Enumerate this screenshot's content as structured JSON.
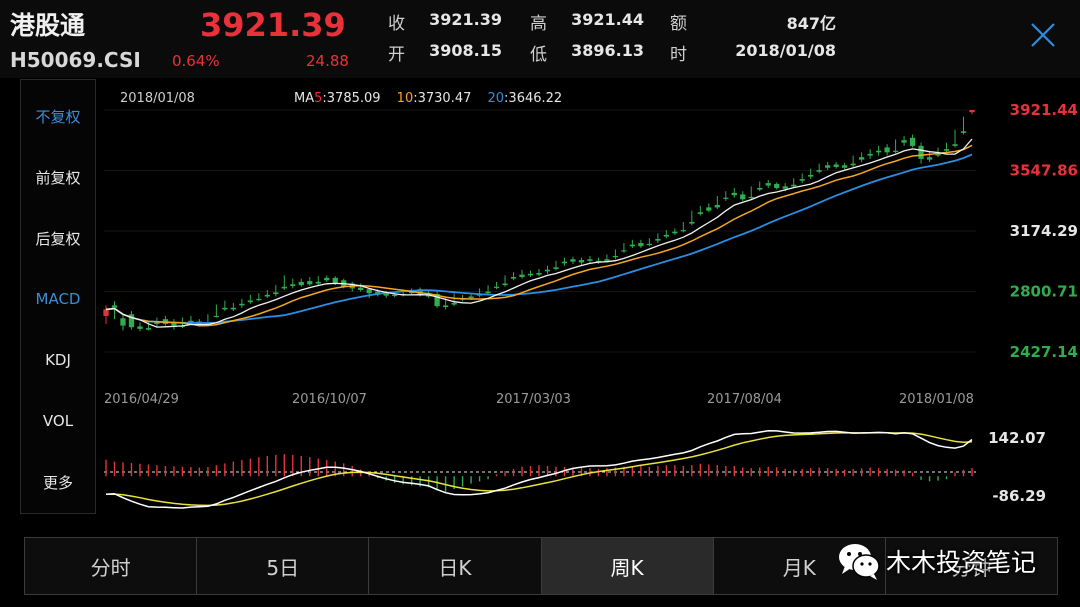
{
  "header": {
    "name": "港股通",
    "code": "H50069.CSI",
    "price": "3921.39",
    "change_pct": "0.64%",
    "change": "24.88",
    "quote": [
      {
        "label": "收",
        "value": "3921.39"
      },
      {
        "label": "高",
        "value": "3921.44"
      },
      {
        "label": "额",
        "value": "847亿"
      },
      {
        "label": "开",
        "value": "3908.15"
      },
      {
        "label": "低",
        "value": "3896.13"
      },
      {
        "label": "时",
        "value": "2018/01/08"
      }
    ]
  },
  "sidebar": {
    "items": [
      {
        "label": "不复权",
        "active": true
      },
      {
        "label": "前复权",
        "active": false
      },
      {
        "label": "后复权",
        "active": false
      },
      {
        "label": "MACD",
        "active": true
      },
      {
        "label": "KDJ",
        "active": false
      },
      {
        "label": "VOL",
        "active": false
      },
      {
        "label": "更多",
        "active": false
      }
    ]
  },
  "legend": {
    "date": "2018/01/08",
    "ma5_prefix": "MA",
    "ma5_num": "5",
    "ma5_value": ":3785.09",
    "ma10_num": "10",
    "ma10_value": ":3730.47",
    "ma20_num": "20",
    "ma20_value": ":3646.22"
  },
  "price_axis": [
    "3921.44",
    "3547.86",
    "3174.29",
    "2800.71",
    "2427.14"
  ],
  "date_axis": [
    "2016/04/29",
    "2016/10/07",
    "2017/03/03",
    "2017/08/04",
    "2018/01/08"
  ],
  "macd_axis": [
    "142.07",
    "-86.29"
  ],
  "tabs": [
    {
      "label": "分时",
      "active": false
    },
    {
      "label": "5日",
      "active": false
    },
    {
      "label": "日K",
      "active": false
    },
    {
      "label": "周K",
      "active": true
    },
    {
      "label": "月K",
      "active": false
    },
    {
      "label": "分钟",
      "active": false
    }
  ],
  "watermark": "木木投资笔记",
  "colors": {
    "up": "#e8323a",
    "down": "#2fae4e",
    "ma5": "#f2f2f2",
    "ma10": "#f5a623",
    "ma20": "#2a8fe0",
    "dif": "#ffffff",
    "dea": "#e8e23a"
  },
  "chart_data": {
    "type": "candlestick",
    "period": "weekly",
    "ylim": [
      2427.14,
      3921.44
    ],
    "macd_ylim": [
      -86.29,
      142.07
    ],
    "x_start": "2016/04/29",
    "x_end": "2018/01/08",
    "candles": [
      [
        2650,
        2715,
        2690,
        2600
      ],
      [
        2715,
        2740,
        2700,
        2630
      ],
      [
        2635,
        2665,
        2590,
        2560
      ],
      [
        2660,
        2680,
        2580,
        2565
      ],
      [
        2585,
        2610,
        2570,
        2555
      ],
      [
        2575,
        2620,
        2565,
        2560
      ],
      [
        2610,
        2640,
        2600,
        2585
      ],
      [
        2630,
        2650,
        2600,
        2590
      ],
      [
        2605,
        2630,
        2590,
        2565
      ],
      [
        2590,
        2640,
        2585,
        2575
      ],
      [
        2620,
        2650,
        2610,
        2595
      ],
      [
        2615,
        2630,
        2600,
        2590
      ],
      [
        2605,
        2660,
        2600,
        2590
      ],
      [
        2650,
        2720,
        2645,
        2640
      ],
      [
        2700,
        2745,
        2690,
        2680
      ],
      [
        2700,
        2730,
        2690,
        2680
      ],
      [
        2725,
        2755,
        2715,
        2700
      ],
      [
        2745,
        2780,
        2735,
        2725
      ],
      [
        2755,
        2790,
        2750,
        2740
      ],
      [
        2780,
        2810,
        2770,
        2760
      ],
      [
        2795,
        2840,
        2785,
        2770
      ],
      [
        2830,
        2900,
        2820,
        2810
      ],
      [
        2845,
        2880,
        2835,
        2820
      ],
      [
        2860,
        2880,
        2840,
        2830
      ],
      [
        2865,
        2890,
        2845,
        2835
      ],
      [
        2860,
        2895,
        2850,
        2840
      ],
      [
        2885,
        2900,
        2870,
        2860
      ],
      [
        2885,
        2895,
        2850,
        2840
      ],
      [
        2870,
        2880,
        2830,
        2820
      ],
      [
        2850,
        2860,
        2820,
        2800
      ],
      [
        2825,
        2850,
        2810,
        2800
      ],
      [
        2815,
        2825,
        2790,
        2760
      ],
      [
        2800,
        2815,
        2780,
        2770
      ],
      [
        2790,
        2805,
        2775,
        2760
      ],
      [
        2780,
        2800,
        2775,
        2765
      ],
      [
        2785,
        2810,
        2780,
        2770
      ],
      [
        2800,
        2820,
        2790,
        2780
      ],
      [
        2815,
        2825,
        2785,
        2770
      ],
      [
        2790,
        2810,
        2770,
        2760
      ],
      [
        2785,
        2800,
        2710,
        2700
      ],
      [
        2715,
        2760,
        2705,
        2690
      ],
      [
        2730,
        2790,
        2720,
        2710
      ],
      [
        2760,
        2780,
        2750,
        2740
      ],
      [
        2770,
        2790,
        2760,
        2750
      ],
      [
        2785,
        2820,
        2775,
        2765
      ],
      [
        2800,
        2840,
        2790,
        2780
      ],
      [
        2830,
        2860,
        2825,
        2815
      ],
      [
        2850,
        2900,
        2840,
        2830
      ],
      [
        2890,
        2920,
        2880,
        2870
      ],
      [
        2905,
        2935,
        2890,
        2880
      ],
      [
        2910,
        2930,
        2900,
        2890
      ],
      [
        2915,
        2940,
        2905,
        2895
      ],
      [
        2935,
        2960,
        2925,
        2910
      ],
      [
        2950,
        2990,
        2940,
        2930
      ],
      [
        2985,
        3010,
        2975,
        2960
      ],
      [
        3000,
        3015,
        2985,
        2970
      ],
      [
        2995,
        3010,
        2980,
        2965
      ],
      [
        3000,
        3020,
        2990,
        2975
      ],
      [
        2990,
        3010,
        2980,
        2970
      ],
      [
        3000,
        3030,
        2990,
        2980
      ],
      [
        3020,
        3060,
        3015,
        3000
      ],
      [
        3055,
        3100,
        3050,
        3040
      ],
      [
        3090,
        3120,
        3080,
        3070
      ],
      [
        3100,
        3120,
        3080,
        3070
      ],
      [
        3095,
        3130,
        3090,
        3080
      ],
      [
        3125,
        3160,
        3115,
        3100
      ],
      [
        3150,
        3180,
        3140,
        3130
      ],
      [
        3170,
        3190,
        3160,
        3150
      ],
      [
        3180,
        3230,
        3175,
        3165
      ],
      [
        3230,
        3300,
        3220,
        3210
      ],
      [
        3290,
        3330,
        3280,
        3270
      ],
      [
        3320,
        3345,
        3300,
        3290
      ],
      [
        3335,
        3390,
        3320,
        3310
      ],
      [
        3380,
        3420,
        3375,
        3360
      ],
      [
        3410,
        3440,
        3395,
        3380
      ],
      [
        3400,
        3420,
        3370,
        3360
      ],
      [
        3385,
        3450,
        3380,
        3370
      ],
      [
        3440,
        3480,
        3430,
        3420
      ],
      [
        3470,
        3490,
        3455,
        3440
      ],
      [
        3465,
        3475,
        3440,
        3430
      ],
      [
        3450,
        3470,
        3435,
        3420
      ],
      [
        3460,
        3500,
        3450,
        3440
      ],
      [
        3495,
        3530,
        3485,
        3470
      ],
      [
        3520,
        3560,
        3510,
        3495
      ],
      [
        3550,
        3590,
        3540,
        3530
      ],
      [
        3580,
        3600,
        3565,
        3550
      ],
      [
        3585,
        3600,
        3570,
        3560
      ],
      [
        3580,
        3595,
        3565,
        3555
      ],
      [
        3590,
        3640,
        3580,
        3570
      ],
      [
        3630,
        3660,
        3615,
        3600
      ],
      [
        3650,
        3680,
        3640,
        3620
      ],
      [
        3670,
        3700,
        3660,
        3640
      ],
      [
        3690,
        3710,
        3660,
        3640
      ],
      [
        3670,
        3740,
        3665,
        3655
      ],
      [
        3735,
        3760,
        3720,
        3700
      ],
      [
        3750,
        3770,
        3700,
        3690
      ],
      [
        3700,
        3720,
        3620,
        3590
      ],
      [
        3630,
        3660,
        3615,
        3600
      ],
      [
        3650,
        3690,
        3640,
        3630
      ],
      [
        3680,
        3720,
        3670,
        3660
      ],
      [
        3710,
        3800,
        3700,
        3690
      ],
      [
        3790,
        3880,
        3780,
        3770
      ],
      [
        3908,
        3921.44,
        3921.39,
        3896.13
      ]
    ],
    "macd_hist": [
      45,
      40,
      38,
      36,
      34,
      32,
      30,
      28,
      27,
      26,
      25,
      24,
      25,
      30,
      35,
      40,
      44,
      48,
      52,
      55,
      58,
      60,
      58,
      55,
      52,
      48,
      44,
      40,
      35,
      28,
      18,
      8,
      -5,
      -12,
      -18,
      -22,
      -25,
      -28,
      -30,
      -38,
      -42,
      -35,
      -28,
      -20,
      -14,
      -8,
      5,
      14,
      20,
      26,
      28,
      30,
      28,
      26,
      25,
      24,
      22,
      22,
      20,
      22,
      24,
      26,
      28,
      28,
      26,
      28,
      30,
      30,
      28,
      30,
      34,
      32,
      30,
      28,
      28,
      24,
      22,
      24,
      26,
      24,
      20,
      18,
      20,
      22,
      24,
      22,
      20,
      18,
      20,
      22,
      24,
      22,
      20,
      18,
      16,
      10,
      -10,
      -14,
      -12,
      -8,
      10,
      18,
      22
    ]
  }
}
